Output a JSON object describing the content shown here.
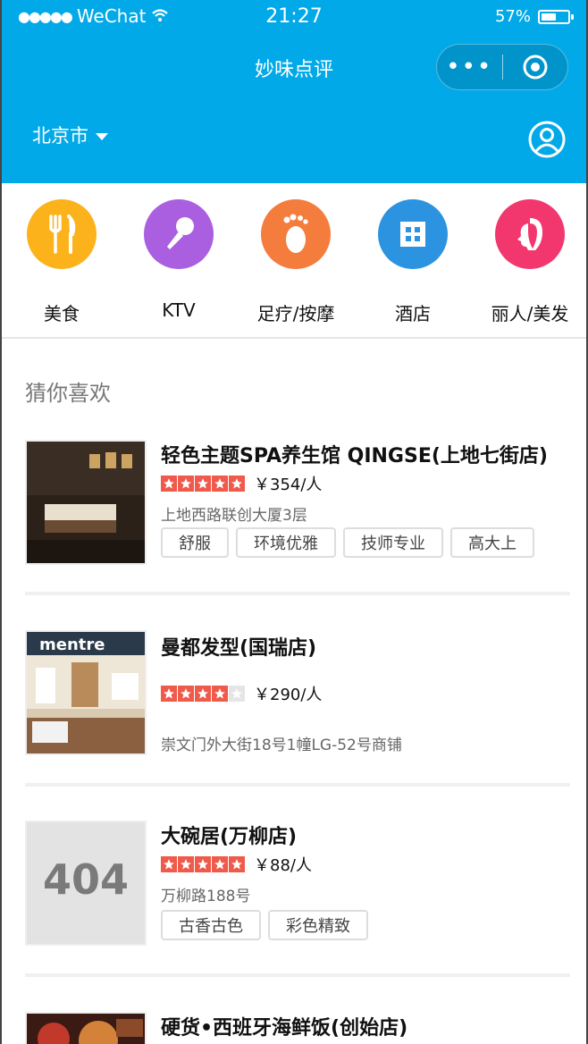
{
  "status_bar": {
    "carrier": "WeChat",
    "time": "21:27",
    "battery": "57%",
    "battery_level": 0.57
  },
  "nav": {
    "title": "妙味点评"
  },
  "location": {
    "city": "北京市"
  },
  "categories": [
    {
      "label": "美食",
      "icon": "fork-knife-icon",
      "color": "#fbb21b"
    },
    {
      "label": "KTV",
      "icon": "microphone-icon",
      "color": "#a95fe0"
    },
    {
      "label": "足疗/按摩",
      "icon": "footprint-icon",
      "color": "#f47c3c"
    },
    {
      "label": "酒店",
      "icon": "building-icon",
      "color": "#2b93df"
    },
    {
      "label": "丽人/美发",
      "icon": "lady-icon",
      "color": "#f2376f"
    }
  ],
  "section": {
    "title": "猜你喜欢"
  },
  "items": [
    {
      "name": "轻色主题SPA养生馆 QINGSE(上地七街店)",
      "stars": 5,
      "price": "￥354/人",
      "address": "上地西路联创大厦3层",
      "tags": [
        "舒服",
        "环境优雅",
        "技师专业",
        "高大上"
      ]
    },
    {
      "name": "曼都发型(国瑞店)",
      "stars": 4,
      "price": "￥290/人",
      "address": "崇文门外大街18号1幢LG-52号商铺",
      "tags": [],
      "thumb_text": "mentre"
    },
    {
      "name": "大碗居(万柳店)",
      "stars": 5,
      "price": "￥88/人",
      "address": "万柳路188号",
      "tags": [
        "古香古色",
        "彩色精致"
      ],
      "thumb_text": "404"
    },
    {
      "name": "硬货•西班牙海鲜饭(创始店)"
    }
  ]
}
